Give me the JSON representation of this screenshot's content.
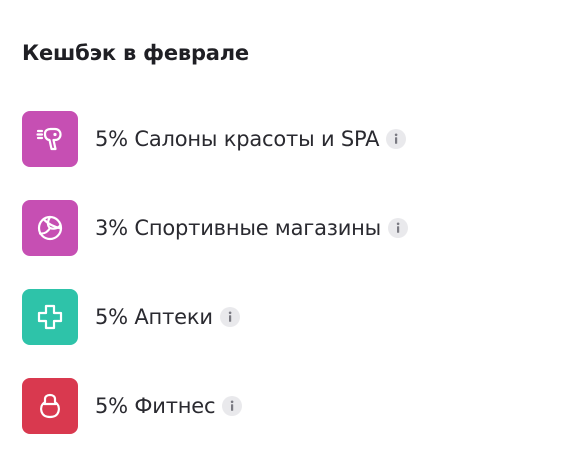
{
  "section": {
    "title": "Кешбэк в феврале"
  },
  "items": [
    {
      "label": "5% Салоны красоты и SPA",
      "icon": "hair-dryer-icon",
      "tile_color": "#c64fb3"
    },
    {
      "label": "3% Спортивные магазины",
      "icon": "volleyball-icon",
      "tile_color": "#c64fb3"
    },
    {
      "label": "5% Аптеки",
      "icon": "medical-cross-icon",
      "tile_color": "#2ec3a9"
    },
    {
      "label": "5% Фитнес",
      "icon": "kettlebell-icon",
      "tile_color": "#d9394f"
    }
  ],
  "info_icon": "info-icon"
}
